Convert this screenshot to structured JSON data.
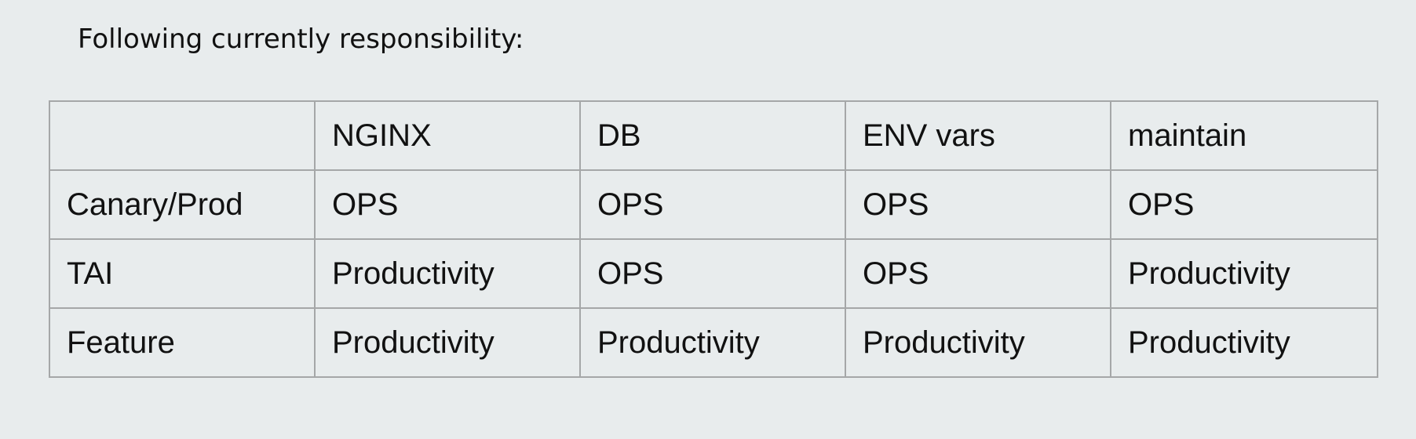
{
  "intro_text": "Following currently responsibility:",
  "table": {
    "header": [
      "",
      "NGINX",
      "DB",
      "ENV vars",
      "maintain"
    ],
    "rows": [
      [
        "Canary/Prod",
        "OPS",
        "OPS",
        "OPS",
        "OPS"
      ],
      [
        "TAI",
        "Productivity",
        "OPS",
        "OPS",
        "Productivity"
      ],
      [
        "Feature",
        "Productivity",
        "Productivity",
        "Productivity",
        "Productivity"
      ]
    ]
  }
}
